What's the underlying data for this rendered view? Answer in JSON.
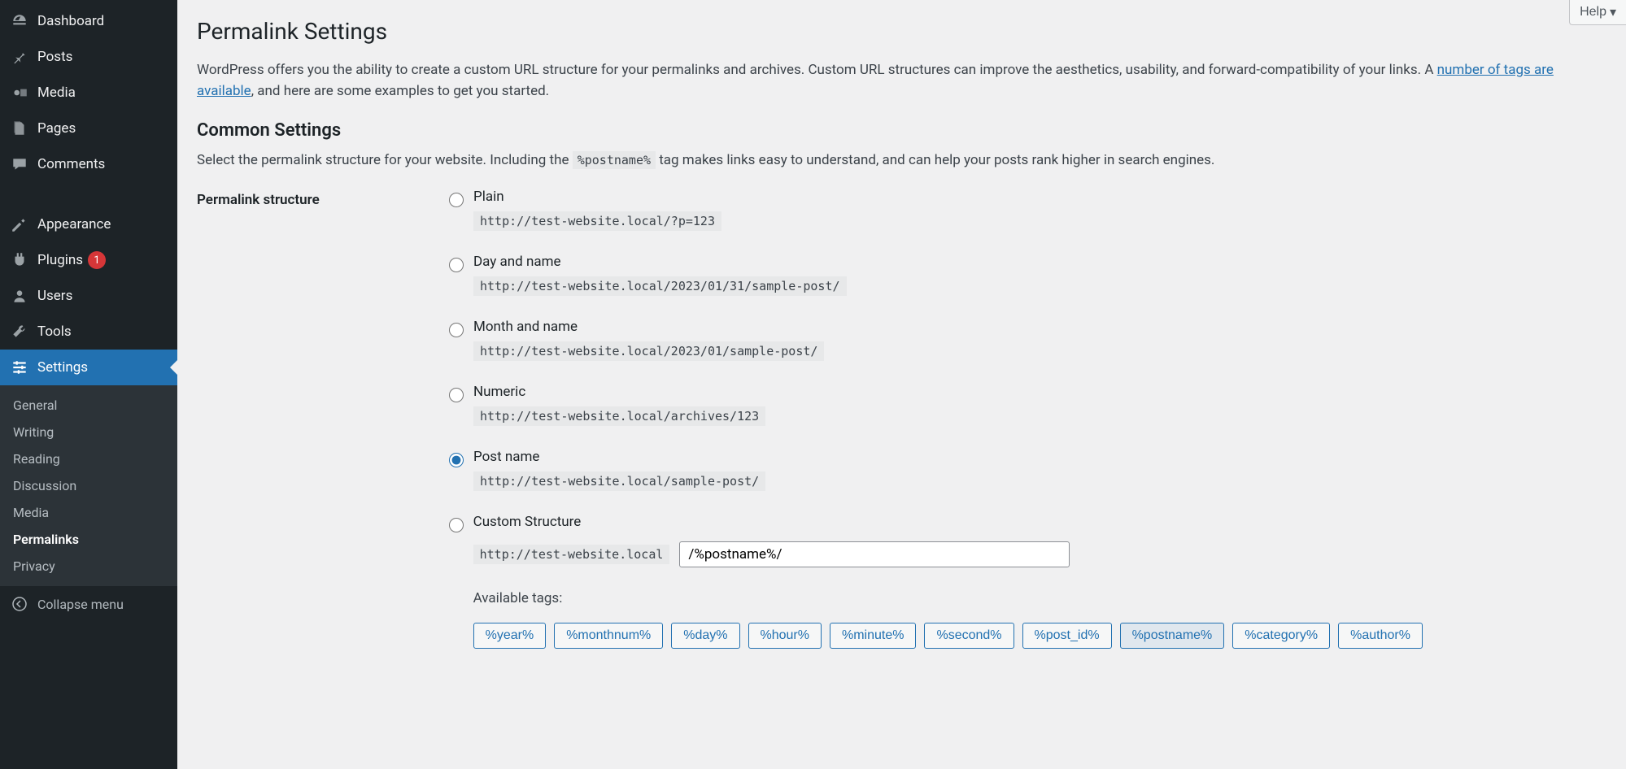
{
  "sidebar": {
    "dashboard": "Dashboard",
    "posts": "Posts",
    "media": "Media",
    "pages": "Pages",
    "comments": "Comments",
    "appearance": "Appearance",
    "plugins": "Plugins",
    "plugins_badge": "1",
    "users": "Users",
    "tools": "Tools",
    "settings": "Settings",
    "submenu": {
      "general": "General",
      "writing": "Writing",
      "reading": "Reading",
      "discussion": "Discussion",
      "media": "Media",
      "permalinks": "Permalinks",
      "privacy": "Privacy"
    },
    "collapse": "Collapse menu"
  },
  "help_label": "Help",
  "page_title": "Permalink Settings",
  "intro_text_1": "WordPress offers you the ability to create a custom URL structure for your permalinks and archives. Custom URL structures can improve the aesthetics, usability, and forward-compatibility of your links. A ",
  "intro_link": "number of tags are available",
  "intro_text_2": ", and here are some examples to get you started.",
  "common_settings_title": "Common Settings",
  "select_text_before": "Select the permalink structure for your website. Including the ",
  "select_tag": "%postname%",
  "select_text_after": " tag makes links easy to understand, and can help your posts rank higher in search engines.",
  "form_label": "Permalink structure",
  "options": {
    "plain": {
      "label": "Plain",
      "example": "http://test-website.local/?p=123"
    },
    "day_name": {
      "label": "Day and name",
      "example": "http://test-website.local/2023/01/31/sample-post/"
    },
    "month_name": {
      "label": "Month and name",
      "example": "http://test-website.local/2023/01/sample-post/"
    },
    "numeric": {
      "label": "Numeric",
      "example": "http://test-website.local/archives/123"
    },
    "post_name": {
      "label": "Post name",
      "example": "http://test-website.local/sample-post/"
    },
    "custom": {
      "label": "Custom Structure",
      "prefix": "http://test-website.local",
      "value": "/%postname%/"
    }
  },
  "available_tags_label": "Available tags:",
  "tags": [
    "%year%",
    "%monthnum%",
    "%day%",
    "%hour%",
    "%minute%",
    "%second%",
    "%post_id%",
    "%postname%",
    "%category%",
    "%author%"
  ]
}
